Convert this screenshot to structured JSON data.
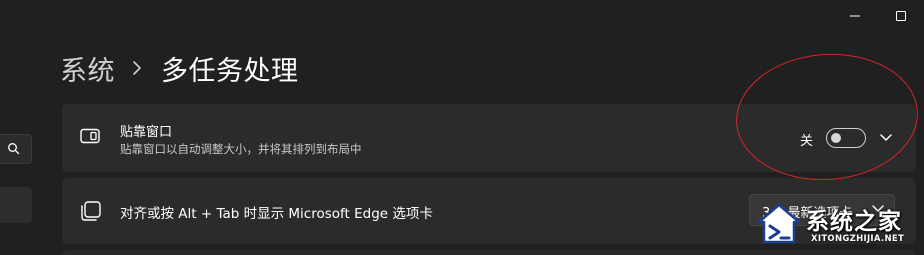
{
  "window": {
    "controls": [
      "minimize",
      "maximize"
    ]
  },
  "breadcrumb": {
    "parent": "系统",
    "current": "多任务处理"
  },
  "settings": {
    "snap": {
      "title": "贴靠窗口",
      "description": "贴靠窗口以自动调整大小，并将其排列到布局中",
      "state_label": "关",
      "toggle_on": false,
      "icon": "snap-window-icon"
    },
    "alt_tab": {
      "title": "对齐或按 Alt + Tab 时显示 Microsoft Edge 选项卡",
      "dropdown_value": "3 个最新选项卡",
      "icon": "edge-tabs-icon"
    }
  },
  "annotation": {
    "color": "#d5252b",
    "shape": "ellipse"
  },
  "watermark": {
    "text_cn": "系统之家",
    "text_en": "XITONGZHIJIA.NET"
  },
  "colors": {
    "background": "#202020",
    "card": "#2b2b2b",
    "text": "#ffffff",
    "secondary_text": "#c8c8c8"
  }
}
